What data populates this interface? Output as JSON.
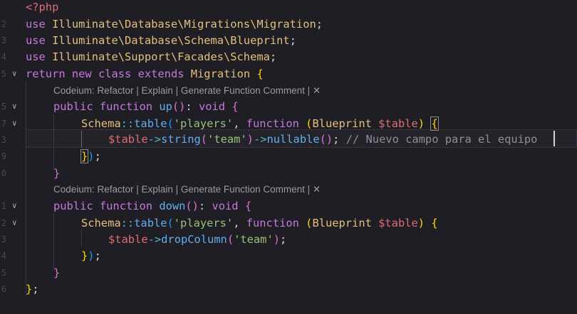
{
  "gutter": {
    "line_numbers": [
      "",
      "2",
      "3",
      "4",
      "5",
      "",
      "5",
      "7",
      "3",
      "9",
      "0",
      "",
      "1",
      "2",
      "3",
      "4",
      "5",
      "6"
    ]
  },
  "codelens": {
    "up": "Codeium: Refactor | Explain | Generate Function Comment | ✕",
    "down": "Codeium: Refactor | Explain | Generate Function Comment | ✕"
  },
  "code": {
    "l1": {
      "open": "<?php"
    },
    "l2": {
      "kw": "use",
      "ns": "Illuminate\\Database\\Migrations\\Migration",
      "semi": ";"
    },
    "l3": {
      "kw": "use",
      "ns": "Illuminate\\Database\\Schema\\Blueprint",
      "semi": ";"
    },
    "l4": {
      "kw": "use",
      "ns": "Illuminate\\Support\\Facades\\Schema",
      "semi": ";"
    },
    "l5": {
      "ret": "return",
      "new": "new",
      "cls": "class",
      "ext": "extends",
      "parent": "Migration",
      "brace": "{"
    },
    "l6": {
      "pub": "public",
      "fn": "function",
      "name": "up",
      "paren": "()",
      "colon": ":",
      "void": "void",
      "brace": "{"
    },
    "l7": {
      "schema": "Schema",
      "dc": "::",
      "method": "table",
      "open": "(",
      "str": "'players'",
      "comma": ",",
      "fn": "function",
      "popen": "(",
      "type": "Blueprint",
      "var": "$table",
      "pclose": ")",
      "brace": "{"
    },
    "l8": {
      "var": "$table",
      "arrow": "->",
      "m1": "string",
      "o1": "(",
      "str": "'team'",
      "c1": ")",
      "arrow2": "->",
      "m2": "nullable",
      "o2": "()",
      "semi": ";",
      "comment": "// Nuevo campo para el equipo"
    },
    "l9": {
      "close": "}",
      "paren": ")",
      "semi": ";"
    },
    "l10": {
      "close": "}"
    },
    "l11": {
      "pub": "public",
      "fn": "function",
      "name": "down",
      "paren": "()",
      "colon": ":",
      "void": "void",
      "brace": "{"
    },
    "l12": {
      "schema": "Schema",
      "dc": "::",
      "method": "table",
      "open": "(",
      "str": "'players'",
      "comma": ",",
      "fn": "function",
      "popen": "(",
      "type": "Blueprint",
      "var": "$table",
      "pclose": ")",
      "brace": "{"
    },
    "l13": {
      "var": "$table",
      "arrow": "->",
      "m1": "dropColumn",
      "o1": "(",
      "str": "'team'",
      "c1": ")",
      "semi": ";"
    },
    "l14": {
      "close": "}",
      "paren": ")",
      "semi": ";"
    },
    "l15": {
      "close": "}"
    },
    "l16": {
      "close": "}",
      "semi": ";"
    }
  },
  "colors": {
    "background": "#1e1e24",
    "keyword": "#c678dd",
    "function": "#61afef",
    "type": "#e5c07b",
    "string": "#98c379",
    "variable": "#e06c75",
    "operator": "#56b6c2",
    "comment": "#8f8f99"
  }
}
